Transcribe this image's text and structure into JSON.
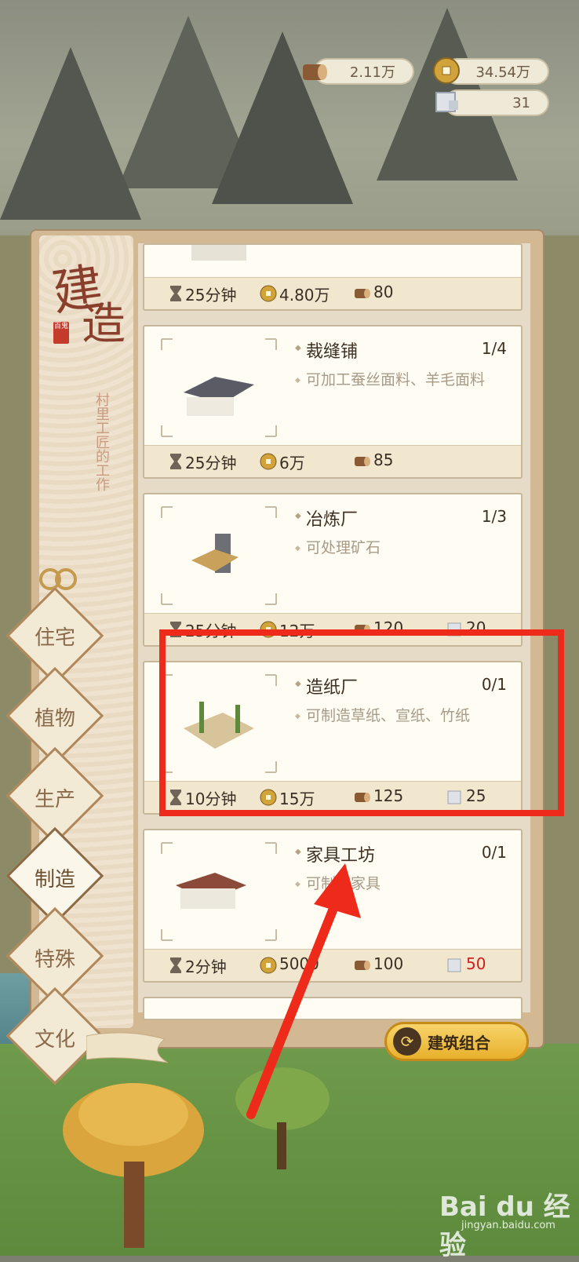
{
  "resources": {
    "wood": "2.11万",
    "copper": "34.54万",
    "stone": "31"
  },
  "panel": {
    "title_char_1": "建",
    "title_char_2": "造",
    "seal_text": "百鬼",
    "subtitle": "村里工匠的工作"
  },
  "categories": [
    {
      "label": "住宅",
      "active": false
    },
    {
      "label": "植物",
      "active": false
    },
    {
      "label": "生产",
      "active": false
    },
    {
      "label": "制造",
      "active": true
    },
    {
      "label": "特殊",
      "active": false
    },
    {
      "label": "文化",
      "active": false
    }
  ],
  "buildings": [
    {
      "name": "",
      "count": "",
      "desc": "",
      "time": "25分钟",
      "coins": "4.80万",
      "wood": "80",
      "stone": ""
    },
    {
      "name": "裁缝铺",
      "count": "1/4",
      "desc": "可加工蚕丝面料、羊毛面料",
      "time": "25分钟",
      "coins": "6万",
      "wood": "85",
      "stone": ""
    },
    {
      "name": "冶炼厂",
      "count": "1/3",
      "desc": "可处理矿石",
      "time": "25分钟",
      "coins": "12万",
      "wood": "120",
      "stone": "20"
    },
    {
      "name": "造纸厂",
      "count": "0/1",
      "desc": "可制造草纸、宣纸、竹纸",
      "time": "10分钟",
      "coins": "15万",
      "wood": "125",
      "stone": "25"
    },
    {
      "name": "家具工坊",
      "count": "0/1",
      "desc": "可制作家具",
      "time": "2分钟",
      "coins": "5000",
      "wood": "100",
      "stone": "50"
    }
  ],
  "combo_button": "建筑组合",
  "colors": {
    "highlight": "#ee2a1b",
    "insufficient": "#cf1f1f"
  },
  "watermark": {
    "brand": "Bai du 经验",
    "url": "jingyan.baidu.com"
  }
}
